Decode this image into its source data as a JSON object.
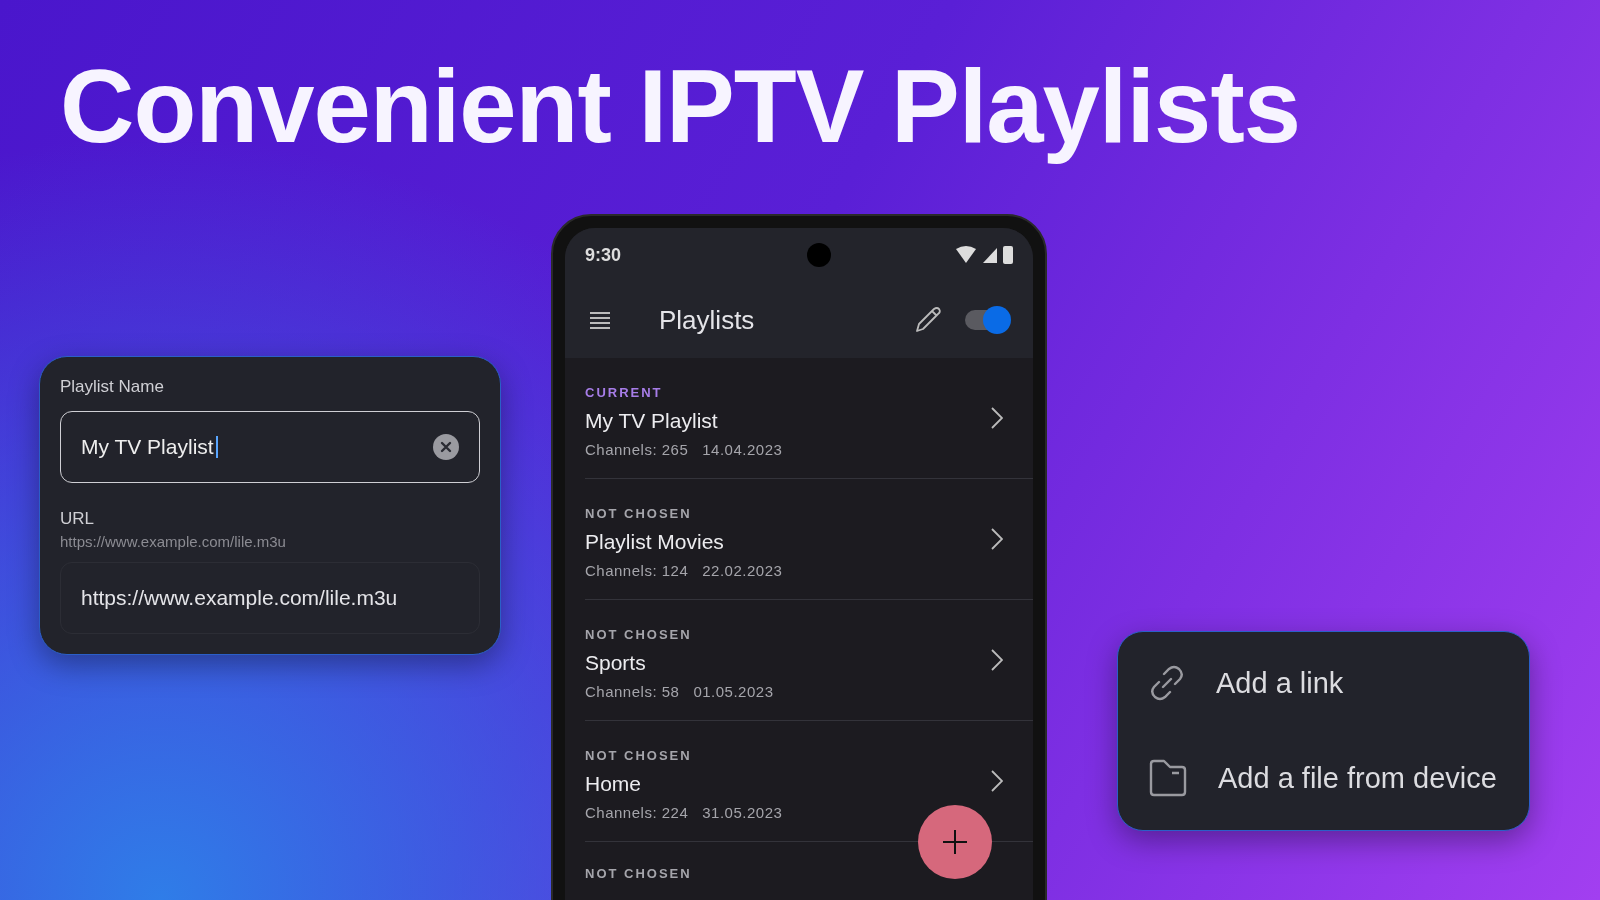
{
  "headline": "Convenient IPTV Playlists",
  "form_card": {
    "name_label": "Playlist Name",
    "name_value": "My TV Playlist",
    "url_label": "URL",
    "url_hint": "https://www.example.com/lile.m3u",
    "url_value": "https://www.example.com/lile.m3u"
  },
  "phone": {
    "status_bar": {
      "time": "9:30"
    },
    "app_bar": {
      "title": "Playlists",
      "toggle_on": true
    },
    "playlists": [
      {
        "status": "CURRENT",
        "current": true,
        "name": "My TV Playlist",
        "channels": "Channels: 265",
        "date": "14.04.2023"
      },
      {
        "status": "NOT CHOSEN",
        "current": false,
        "name": "Playlist Movies",
        "channels": "Channels: 124",
        "date": "22.02.2023"
      },
      {
        "status": "NOT CHOSEN",
        "current": false,
        "name": "Sports",
        "channels": "Channels: 58",
        "date": "01.05.2023"
      },
      {
        "status": "NOT CHOSEN",
        "current": false,
        "name": "Home",
        "channels": "Channels: 224",
        "date": "31.05.2023"
      },
      {
        "status": "NOT CHOSEN",
        "current": false
      }
    ]
  },
  "add_menu": [
    {
      "kind": "link",
      "label": "Add a link"
    },
    {
      "kind": "file",
      "label": "Add a file from device"
    }
  ]
}
